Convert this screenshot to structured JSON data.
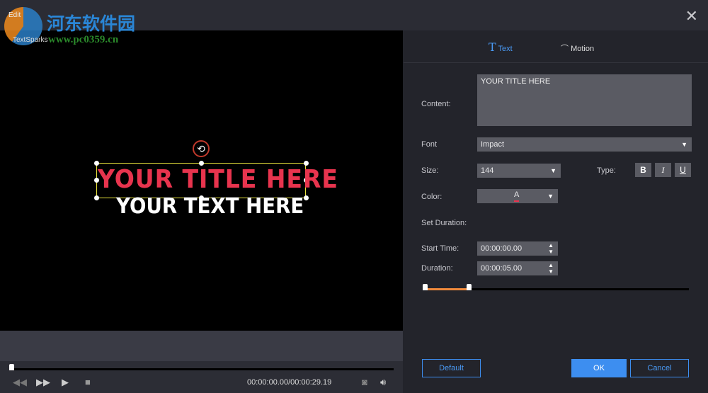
{
  "window": {
    "title": "Edit",
    "subtitle": "TextSparks",
    "close_icon": "close-icon"
  },
  "watermark": {
    "name": "河东软件园",
    "url": "www.pc0359.cn"
  },
  "preview": {
    "title_text": "YOUR TITLE HERE",
    "body_text": "YOUR TEXT HERE",
    "rotate_icon": "⟲"
  },
  "player": {
    "time": "00:00:00.00/00:00:29.19",
    "progress": 0
  },
  "tabs": [
    {
      "label": "Text",
      "icon": "T"
    },
    {
      "label": "Motion",
      "icon": "motion-icon"
    }
  ],
  "form": {
    "content_label": "Content:",
    "content_value": "YOUR TITLE HERE",
    "font_label": "Font",
    "font_value": "Impact",
    "size_label": "Size:",
    "size_value": "144",
    "type_label": "Type:",
    "bold": "B",
    "italic": "I",
    "underline": "U",
    "color_label": "Color:",
    "color_value": "A",
    "color_hex": "#e8344e",
    "set_duration_label": "Set Duration:",
    "start_label": "Start Time:",
    "start_value": "00:00:00.00",
    "duration_label": "Duration:",
    "duration_value": "00:00:05.00",
    "accent": "#f08a3c"
  },
  "buttons": {
    "default": "Default",
    "ok": "OK",
    "cancel": "Cancel"
  }
}
